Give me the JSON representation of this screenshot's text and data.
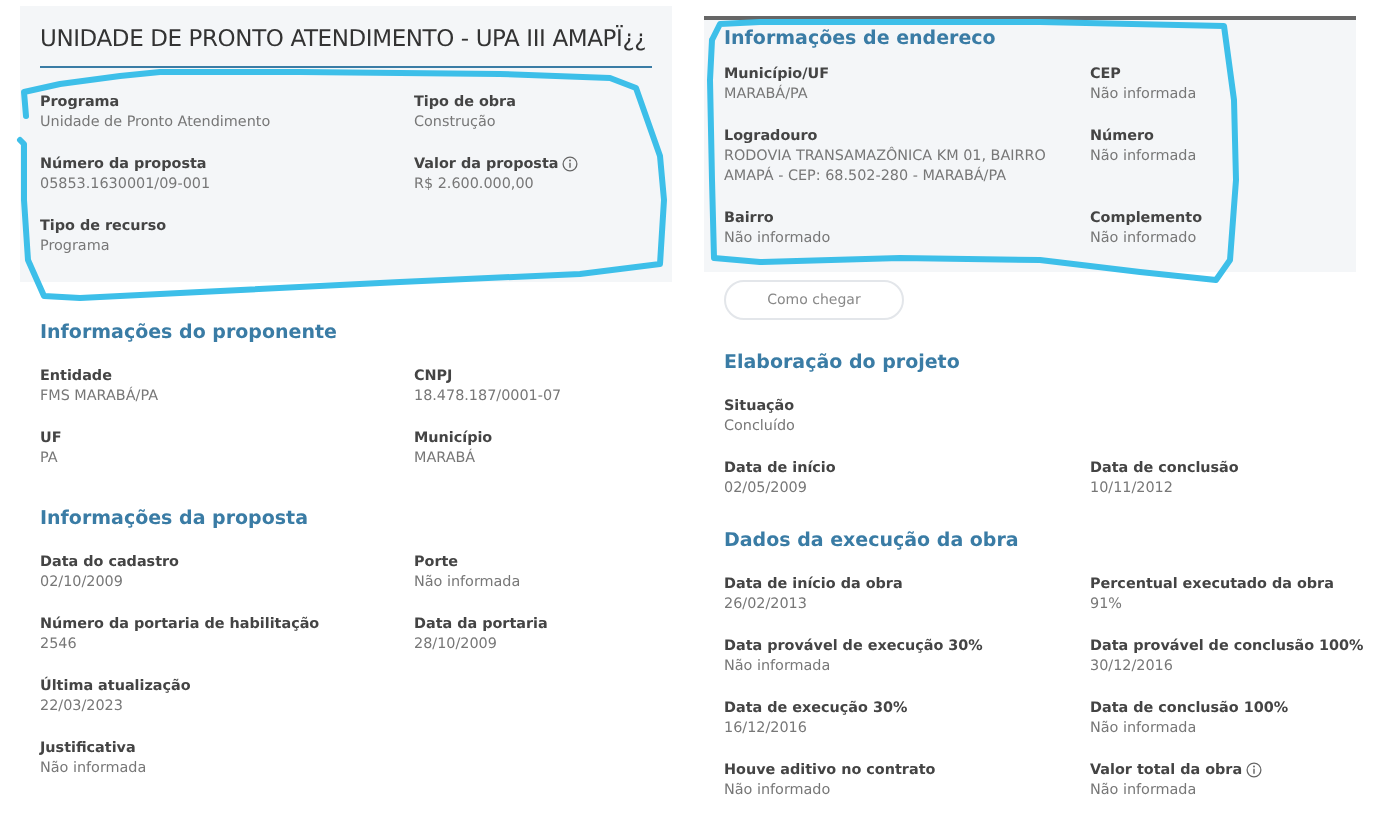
{
  "left": {
    "title": "UNIDADE DE PRONTO ATENDIMENTO - UPA III AMAPÏ¿¿",
    "card_rows": [
      [
        {
          "label": "Programa",
          "value": "Unidade de Pronto Atendimento"
        },
        {
          "label": "Tipo de obra",
          "value": "Construção"
        }
      ],
      [
        {
          "label": "Número da proposta",
          "value": "05853.1630001/09-001"
        },
        {
          "label": "Valor da proposta",
          "value": "R$ 2.600.000,00",
          "info": true
        }
      ],
      [
        {
          "label": "Tipo de recurso",
          "value": "Programa"
        }
      ]
    ],
    "sections": [
      {
        "heading": "Informações do proponente",
        "rows": [
          [
            {
              "label": "Entidade",
              "value": "FMS MARABÁ/PA"
            },
            {
              "label": "CNPJ",
              "value": "18.478.187/0001-07"
            }
          ],
          [
            {
              "label": "UF",
              "value": "PA"
            },
            {
              "label": "Município",
              "value": "MARABÁ"
            }
          ]
        ]
      },
      {
        "heading": "Informações da proposta",
        "rows": [
          [
            {
              "label": "Data do cadastro",
              "value": "02/10/2009"
            },
            {
              "label": "Porte",
              "value": "Não informada"
            }
          ],
          [
            {
              "label": "Número da portaria de habilitação",
              "value": "2546"
            },
            {
              "label": "Data da portaria",
              "value": "28/10/2009"
            }
          ],
          [
            {
              "label": "Última atualização",
              "value": "22/03/2023"
            }
          ],
          [
            {
              "label": "Justificativa",
              "value": "Não informada"
            }
          ]
        ]
      }
    ]
  },
  "right": {
    "card_heading": "Informações de endereco",
    "card_rows": [
      [
        {
          "label": "Município/UF",
          "value": "MARABÁ/PA"
        },
        {
          "label": "CEP",
          "value": "Não informada"
        }
      ],
      [
        {
          "label": "Logradouro",
          "value": "RODOVIA TRANSAMAZÔNICA KM 01, BAIRRO AMAPÁ - CEP: 68.502-280 - MARABÁ/PA"
        },
        {
          "label": "Número",
          "value": "Não informada"
        }
      ],
      [
        {
          "label": "Bairro",
          "value": "Não informado"
        },
        {
          "label": "Complemento",
          "value": "Não informado"
        }
      ]
    ],
    "button": "Como chegar",
    "sections": [
      {
        "heading": "Elaboração do projeto",
        "rows": [
          [
            {
              "label": "Situação",
              "value": "Concluído"
            }
          ],
          [
            {
              "label": "Data de início",
              "value": "02/05/2009"
            },
            {
              "label": "Data de conclusão",
              "value": "10/11/2012"
            }
          ]
        ]
      },
      {
        "heading": "Dados da execução da obra",
        "rows": [
          [
            {
              "label": "Data de início da obra",
              "value": "26/02/2013"
            },
            {
              "label": "Percentual executado da obra",
              "value": "91%"
            }
          ],
          [
            {
              "label": "Data provável de execução 30%",
              "value": "Não informada"
            },
            {
              "label": "Data provável de conclusão 100%",
              "value": "30/12/2016"
            }
          ],
          [
            {
              "label": "Data de execução 30%",
              "value": "16/12/2016"
            },
            {
              "label": "Data de conclusão 100%",
              "value": "Não informada"
            }
          ],
          [
            {
              "label": "Houve aditivo no contrato",
              "value": "Não informado"
            },
            {
              "label": "Valor total da obra",
              "value": "Não informada",
              "info": true
            }
          ]
        ]
      }
    ]
  }
}
